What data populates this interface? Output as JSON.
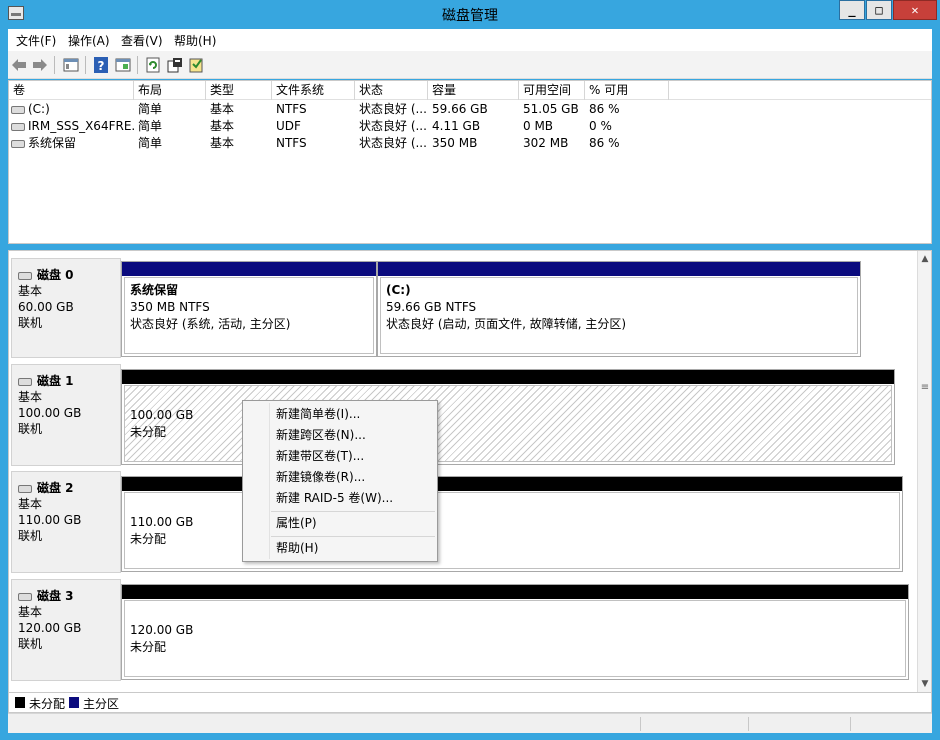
{
  "window": {
    "title": "磁盘管理",
    "min": "_",
    "max": "□",
    "close": "✕"
  },
  "menu": [
    "文件(F)",
    "操作(A)",
    "查看(V)",
    "帮助(H)"
  ],
  "toolbar_icons": [
    "back-arrow-icon",
    "forward-arrow-icon",
    "console-tree-icon",
    "help-icon",
    "show-pane-icon",
    "refresh-icon",
    "properties-icon",
    "export-icon"
  ],
  "volumes": {
    "columns": [
      "卷",
      "布局",
      "类型",
      "文件系统",
      "状态",
      "容量",
      "可用空间",
      "% 可用"
    ],
    "rows": [
      {
        "name": "(C:)",
        "layout": "简单",
        "type": "基本",
        "fs": "NTFS",
        "status": "状态良好 (...",
        "capacity": "59.66 GB",
        "free": "51.05 GB",
        "pct": "86 %"
      },
      {
        "name": "IRM_SSS_X64FRE...",
        "layout": "简单",
        "type": "基本",
        "fs": "UDF",
        "status": "状态良好 (...",
        "capacity": "4.11 GB",
        "free": "0 MB",
        "pct": "0 %"
      },
      {
        "name": "系统保留",
        "layout": "简单",
        "type": "基本",
        "fs": "NTFS",
        "status": "状态良好 (...",
        "capacity": "350 MB",
        "free": "302 MB",
        "pct": "86 %"
      }
    ]
  },
  "disks": [
    {
      "name": "磁盘 0",
      "type": "基本",
      "size": "60.00 GB",
      "state": "联机",
      "partitions": [
        {
          "title": "系统保留",
          "size": "350 MB NTFS",
          "status": "状态良好 (系统, 活动, 主分区)"
        },
        {
          "title": "(C:)",
          "size": "59.66 GB NTFS",
          "status": "状态良好 (启动, 页面文件, 故障转储, 主分区)"
        }
      ]
    },
    {
      "name": "磁盘 1",
      "type": "基本",
      "size": "100.00 GB",
      "state": "联机",
      "partitions": [
        {
          "size": "100.00 GB",
          "status": "未分配"
        }
      ]
    },
    {
      "name": "磁盘 2",
      "type": "基本",
      "size": "110.00 GB",
      "state": "联机",
      "partitions": [
        {
          "size": "110.00 GB",
          "status": "未分配"
        }
      ]
    },
    {
      "name": "磁盘 3",
      "type": "基本",
      "size": "120.00 GB",
      "state": "联机",
      "partitions": [
        {
          "size": "120.00 GB",
          "status": "未分配"
        }
      ]
    }
  ],
  "legend": [
    {
      "label": "未分配",
      "color": "#000000"
    },
    {
      "label": "主分区",
      "color": "#0b0b7e"
    }
  ],
  "context_menu": {
    "items": [
      "新建简单卷(I)...",
      "新建跨区卷(N)...",
      "新建带区卷(T)...",
      "新建镜像卷(R)...",
      "新建 RAID-5 卷(W)..."
    ],
    "properties": "属性(P)",
    "help": "帮助(H)"
  },
  "scrollbar": {
    "up": "▲",
    "down": "▼",
    "grip": "≡"
  }
}
